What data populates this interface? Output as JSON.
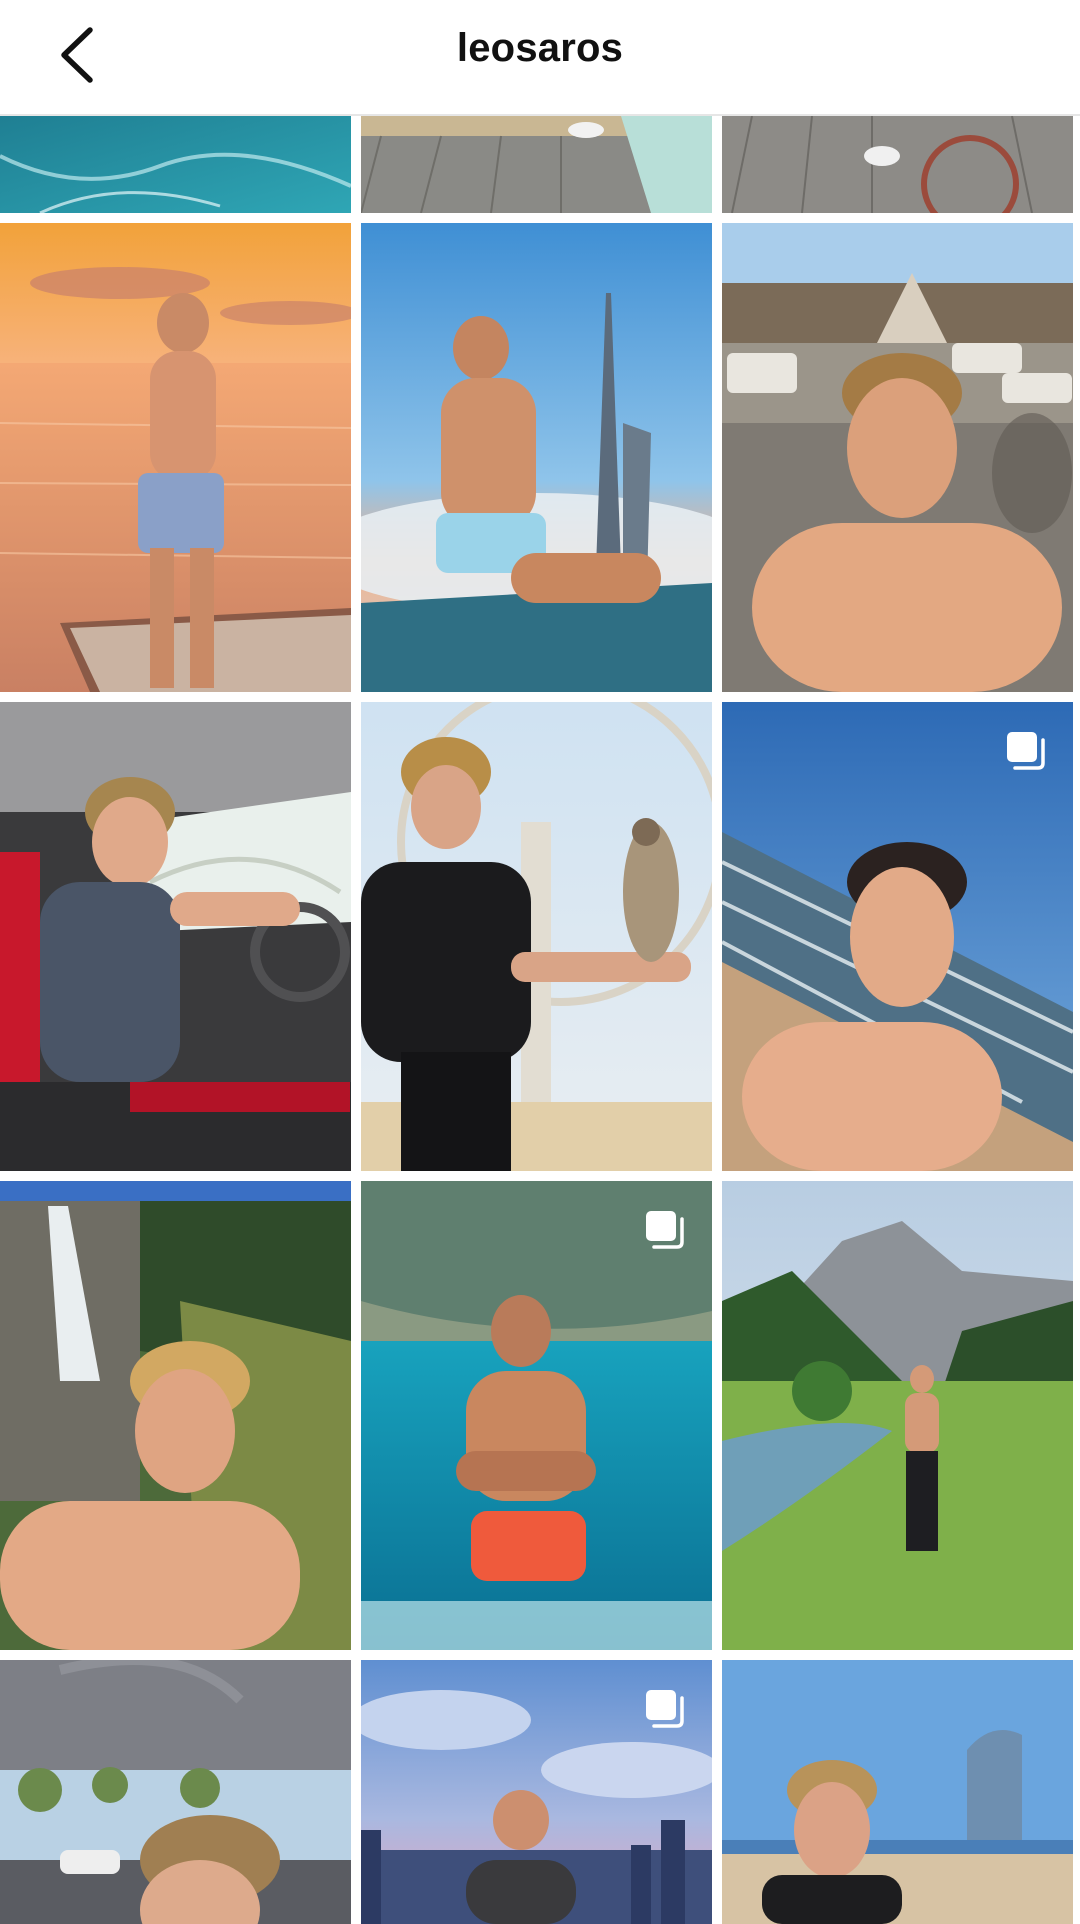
{
  "header": {
    "title": "leosaros",
    "back_icon": "chevron-left-icon"
  },
  "grid": {
    "multi_photo_icon": "stacked-squares-icon",
    "posts": [
      {
        "id": "post-1",
        "desc": "pool-water",
        "multi": false
      },
      {
        "id": "post-2",
        "desc": "wooden-deck-sneakers",
        "multi": false
      },
      {
        "id": "post-3",
        "desc": "deck-bicycle",
        "multi": false
      },
      {
        "id": "post-4",
        "desc": "sunset-sea-net",
        "multi": false
      },
      {
        "id": "post-5",
        "desc": "skyline-tower-clouds",
        "multi": false
      },
      {
        "id": "post-6",
        "desc": "beach-loungers-selfie",
        "multi": false
      },
      {
        "id": "post-7",
        "desc": "sports-car-driver",
        "multi": false
      },
      {
        "id": "post-8",
        "desc": "falcon-ferris-wheel",
        "multi": false
      },
      {
        "id": "post-9",
        "desc": "beach-waves-selfie",
        "multi": true
      },
      {
        "id": "post-10",
        "desc": "waterfall-selfie",
        "multi": false
      },
      {
        "id": "post-11",
        "desc": "turquoise-cave-water",
        "multi": true
      },
      {
        "id": "post-12",
        "desc": "mountain-meadow-river",
        "multi": false
      },
      {
        "id": "post-13",
        "desc": "car-interior-selfie",
        "multi": false
      },
      {
        "id": "post-14",
        "desc": "city-skyline-dusk",
        "multi": true
      },
      {
        "id": "post-15",
        "desc": "beach-skyscraper",
        "multi": false
      }
    ]
  }
}
